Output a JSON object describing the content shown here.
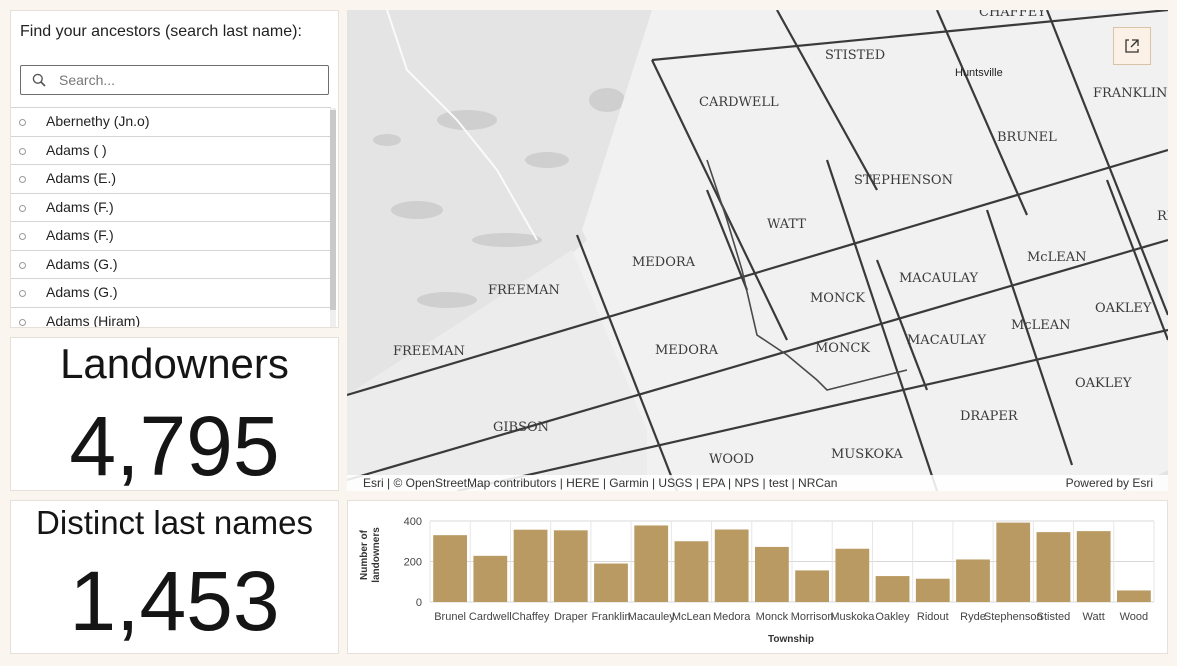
{
  "list_panel": {
    "title": "Find your ancestors (search last name):",
    "search_placeholder": "Search...",
    "items": [
      {
        "label": "Abernethy (Jn.o)"
      },
      {
        "label": "Adams ( )"
      },
      {
        "label": "Adams (E.)"
      },
      {
        "label": "Adams (F.)"
      },
      {
        "label": "Adams (F.)"
      },
      {
        "label": "Adams (G.)"
      },
      {
        "label": "Adams (G.)"
      },
      {
        "label": "Adams (Hiram)"
      }
    ]
  },
  "landowners": {
    "title": "Landowners",
    "value": "4,795"
  },
  "distinct_names": {
    "title": "Distinct last names",
    "value": "1,453"
  },
  "map": {
    "attribution": "Esri | © OpenStreetMap contributors | HERE | Garmin | USGS | EPA | NPS | test | NRCan",
    "powered_by": "Powered by Esri",
    "labels": [
      "CHAFFEY",
      "STISTED",
      "Huntsville",
      "FRANKLIN",
      "CARDWELL",
      "BRUNEL",
      "STEPHENSON",
      "WATT",
      "RID",
      "MEDORA",
      "FREEMAN",
      "McLEAN",
      "MACAULAY",
      "MONCK",
      "OAKLEY",
      "FREEMAN",
      "MEDORA",
      "McLEAN",
      "MONCK",
      "MACAULAY",
      "OAKLEY",
      "DRAPER",
      "GIBSON",
      "WOOD",
      "MUSKOKA"
    ]
  },
  "icons": {
    "search": "search-icon",
    "expand": "external-link-icon",
    "radio": "radio-icon"
  },
  "colors": {
    "bar": "#b99a62",
    "accent_border": "#d9c3a6"
  },
  "chart_data": {
    "type": "bar",
    "categories": [
      "Brunel",
      "Cardwell",
      "Chaffey",
      "Draper",
      "Franklin",
      "Macauley",
      "McLean",
      "Medora",
      "Monck",
      "Morrison",
      "Muskoka",
      "Oakley",
      "Ridout",
      "Ryde",
      "Stephenson",
      "Stisted",
      "Watt",
      "Wood"
    ],
    "values": [
      330,
      228,
      357,
      354,
      190,
      378,
      300,
      358,
      272,
      156,
      263,
      128,
      115,
      210,
      392,
      345,
      350,
      57
    ],
    "xlabel": "Township",
    "ylabel": "Number of landowners",
    "yticks": [
      "0",
      "200",
      "400"
    ],
    "ylim": [
      0,
      400
    ],
    "grid": true
  }
}
